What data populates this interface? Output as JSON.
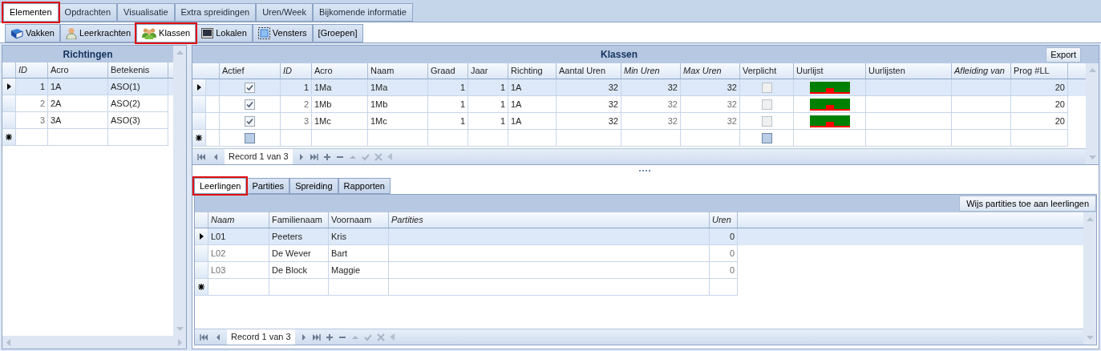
{
  "main_tabs": [
    {
      "label": "Elementen",
      "selected": true
    },
    {
      "label": "Opdrachten",
      "selected": false
    },
    {
      "label": "Visualisatie",
      "selected": false
    },
    {
      "label": "Extra spreidingen",
      "selected": false
    },
    {
      "label": "Uren/Week",
      "selected": false
    },
    {
      "label": "Bijkomende informatie",
      "selected": false
    }
  ],
  "sub_tabs": [
    {
      "label": "Vakken",
      "kind": "book",
      "selected": false
    },
    {
      "label": "Leerkrachten",
      "kind": "person",
      "selected": false
    },
    {
      "label": "Klassen",
      "kind": "group",
      "selected": true
    },
    {
      "label": "Lokalen",
      "kind": "screen",
      "selected": false
    },
    {
      "label": "Vensters",
      "kind": "frame",
      "selected": false
    },
    {
      "label": "[Groepen]",
      "kind": "none",
      "selected": false
    }
  ],
  "richtingen": {
    "title": "Richtingen",
    "columns": [
      {
        "label": "ID",
        "kind": "number",
        "italic": true
      },
      {
        "label": "Acro",
        "kind": "text",
        "italic": false
      },
      {
        "label": "Betekenis",
        "kind": "text",
        "italic": false
      }
    ],
    "rows": [
      {
        "selected": true,
        "cells": [
          "1",
          "1A",
          "ASO(1)"
        ]
      },
      {
        "selected": false,
        "cells": [
          "2",
          "2A",
          "ASO(2)"
        ]
      },
      {
        "selected": false,
        "cells": [
          "3",
          "3A",
          "ASO(3)"
        ]
      }
    ]
  },
  "klassen": {
    "title": "Klassen",
    "export_button": "Export",
    "record": "Record 1 van 3",
    "columns": [
      {
        "label": "Actief",
        "kind": "check",
        "italic": false
      },
      {
        "label": "ID",
        "kind": "number",
        "italic": true
      },
      {
        "label": "Acro",
        "kind": "text",
        "italic": false
      },
      {
        "label": "Naam",
        "kind": "text",
        "italic": false
      },
      {
        "label": "Graad",
        "kind": "number",
        "italic": false
      },
      {
        "label": "Jaar",
        "kind": "number",
        "italic": false
      },
      {
        "label": "Richting",
        "kind": "text",
        "italic": false
      },
      {
        "label": "Aantal Uren",
        "kind": "number",
        "italic": false
      },
      {
        "label": "Min Uren",
        "kind": "number",
        "italic": true
      },
      {
        "label": "Max Uren",
        "kind": "number",
        "italic": true
      },
      {
        "label": "Verplicht",
        "kind": "check",
        "italic": false
      },
      {
        "label": "Uurlijst",
        "kind": "schedule",
        "italic": false
      },
      {
        "label": "Uurlijsten",
        "kind": "text",
        "italic": false
      },
      {
        "label": "Afleiding van",
        "kind": "text",
        "italic": true
      },
      {
        "label": "Prog #LL",
        "kind": "number",
        "italic": false
      }
    ],
    "rows": [
      {
        "selected": true,
        "cells": [
          true,
          "1",
          "1Ma",
          "1Ma",
          "1",
          "1",
          "1A",
          "32",
          "32",
          "32",
          false,
          "",
          "",
          "",
          "20"
        ]
      },
      {
        "selected": false,
        "cells": [
          true,
          "2",
          "1Mb",
          "1Mb",
          "1",
          "1",
          "1A",
          "32",
          "32",
          "32",
          false,
          "",
          "",
          "",
          "20"
        ]
      },
      {
        "selected": false,
        "cells": [
          true,
          "3",
          "1Mc",
          "1Mc",
          "1",
          "1",
          "1A",
          "32",
          "32",
          "32",
          false,
          "",
          "",
          "",
          "20"
        ]
      }
    ],
    "new_row": {
      "cells": [
        false,
        "",
        "",
        "",
        "",
        "",
        "",
        "",
        "",
        "",
        false,
        "",
        "",
        "",
        ""
      ]
    }
  },
  "detail_tabs": [
    {
      "label": "Leerlingen",
      "selected": true
    },
    {
      "label": "Partities",
      "selected": false
    },
    {
      "label": "Spreiding",
      "selected": false
    },
    {
      "label": "Rapporten",
      "selected": false
    }
  ],
  "leerlingen": {
    "assign_button": "Wijs partities toe aan leerlingen",
    "record": "Record 1 van 3",
    "columns": [
      {
        "label": "Naam",
        "kind": "text",
        "italic": true
      },
      {
        "label": "Familienaam",
        "kind": "text",
        "italic": false
      },
      {
        "label": "Voornaam",
        "kind": "text",
        "italic": false
      },
      {
        "label": "Partities",
        "kind": "text",
        "italic": true
      },
      {
        "label": "Uren",
        "kind": "number",
        "italic": true
      }
    ],
    "rows": [
      {
        "selected": true,
        "cells": [
          "L01",
          "Peeters",
          "Kris",
          "",
          "0"
        ]
      },
      {
        "selected": false,
        "cells": [
          "L02",
          "De Wever",
          "Bart",
          "",
          "0"
        ]
      },
      {
        "selected": false,
        "cells": [
          "L03",
          "De Block",
          "Maggie",
          "",
          "0"
        ]
      }
    ]
  }
}
